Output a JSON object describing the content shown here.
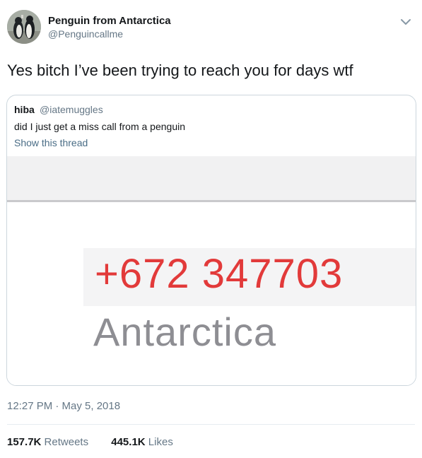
{
  "author": {
    "name": "Penguin from Antarctica",
    "handle": "@Penguincallme",
    "avatar_icon": "penguins-avatar"
  },
  "tweet": {
    "text": "Yes bitch I’ve been trying to reach you for days wtf",
    "timestamp": "12:27 PM · May 5, 2018"
  },
  "quoted": {
    "name": "hiba",
    "handle": "@iatemuggles",
    "text": "did I just get a miss call from a penguin",
    "show_thread": "Show this thread",
    "media": {
      "phone_number": "+672 347703",
      "location": "Antarctica"
    }
  },
  "stats": {
    "retweets_count": "157.7K",
    "retweets_label": "Retweets",
    "likes_count": "445.1K",
    "likes_label": "Likes"
  },
  "colors": {
    "phone_red": "#e23a3a",
    "link_blue": "#4a6d86",
    "muted_gray": "#657786",
    "border": "#ccd6dd"
  }
}
